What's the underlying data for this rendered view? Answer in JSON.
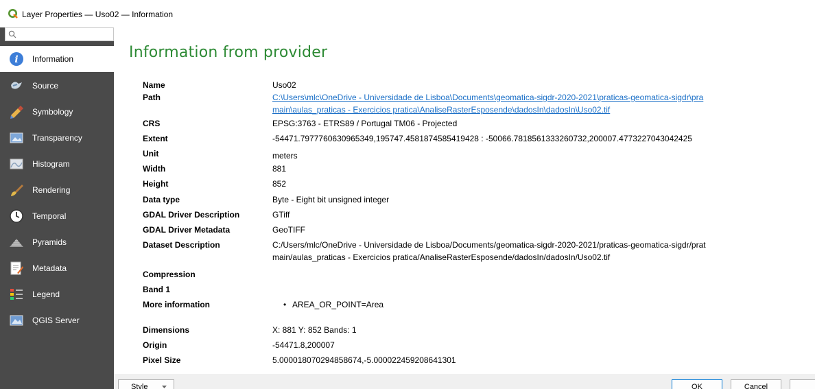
{
  "window": {
    "title": "Layer Properties — Uso02 — Information"
  },
  "sidebar": {
    "search_placeholder": "",
    "items": [
      {
        "label": "Information",
        "icon": "information-icon",
        "active": true
      },
      {
        "label": "Source",
        "icon": "source-icon"
      },
      {
        "label": "Symbology",
        "icon": "symbology-icon"
      },
      {
        "label": "Transparency",
        "icon": "transparency-icon"
      },
      {
        "label": "Histogram",
        "icon": "histogram-icon"
      },
      {
        "label": "Rendering",
        "icon": "rendering-icon"
      },
      {
        "label": "Temporal",
        "icon": "temporal-icon"
      },
      {
        "label": "Pyramids",
        "icon": "pyramids-icon"
      },
      {
        "label": "Metadata",
        "icon": "metadata-icon"
      },
      {
        "label": "Legend",
        "icon": "legend-icon"
      },
      {
        "label": "QGIS Server",
        "icon": "qgis-server-icon"
      }
    ]
  },
  "main": {
    "heading": "Information from provider",
    "rows": {
      "name": {
        "key": "Name",
        "value": "Uso02"
      },
      "path": {
        "key": "Path",
        "line1": "C:\\Users\\mlc\\OneDrive - Universidade de Lisboa\\Documents\\geomatica-sigdr-2020-2021\\praticas-geomatica-sigdr\\pra",
        "line2": "main\\aulas_praticas - Exercicios pratica\\AnaliseRasterEsposende\\dadosIn\\dadosIn\\Uso02.tif"
      },
      "crs": {
        "key": "CRS",
        "value": "EPSG:3763 - ETRS89 / Portugal TM06 - Projected"
      },
      "extent": {
        "key": "Extent",
        "value": "-54471.7977760630965349,195747.4581874585419428 : -50066.7818561333260732,200007.4773227043042425"
      },
      "unit": {
        "key": "Unit",
        "value": "meters"
      },
      "width": {
        "key": "Width",
        "value": "881"
      },
      "height": {
        "key": "Height",
        "value": "852"
      },
      "data_type": {
        "key": "Data type",
        "value": "Byte - Eight bit unsigned integer"
      },
      "gdal_desc": {
        "key": "GDAL Driver Description",
        "value": "GTiff"
      },
      "gdal_meta": {
        "key": "GDAL Driver Metadata",
        "value": "GeoTIFF"
      },
      "dataset_desc": {
        "key": "Dataset Description",
        "line1": "C:/Users/mlc/OneDrive - Universidade de Lisboa/Documents/geomatica-sigdr-2020-2021/praticas-geomatica-sigdr/prat",
        "line2": "main/aulas_praticas - Exercicios pratica/AnaliseRasterEsposende/dadosIn/dadosIn/Uso02.tif"
      },
      "compression": {
        "key": "Compression"
      },
      "band1": {
        "key": "Band 1"
      },
      "more_info": {
        "key": "More information",
        "value": "AREA_OR_POINT=Area"
      },
      "dimensions": {
        "key": "Dimensions",
        "value": "X: 881 Y: 852 Bands: 1"
      },
      "origin": {
        "key": "Origin",
        "value": "-54471.8,200007"
      },
      "pixel_size": {
        "key": "Pixel Size",
        "value": "5.000018070294858674,-5.000022459208641301"
      }
    }
  },
  "footer": {
    "style_label": "Style",
    "ok_label": "OK",
    "cancel_label": "Cancel"
  },
  "colors": {
    "sidebar_bg": "#4a4a4a",
    "heading": "#2d8a34",
    "link": "#1a6fc7"
  }
}
